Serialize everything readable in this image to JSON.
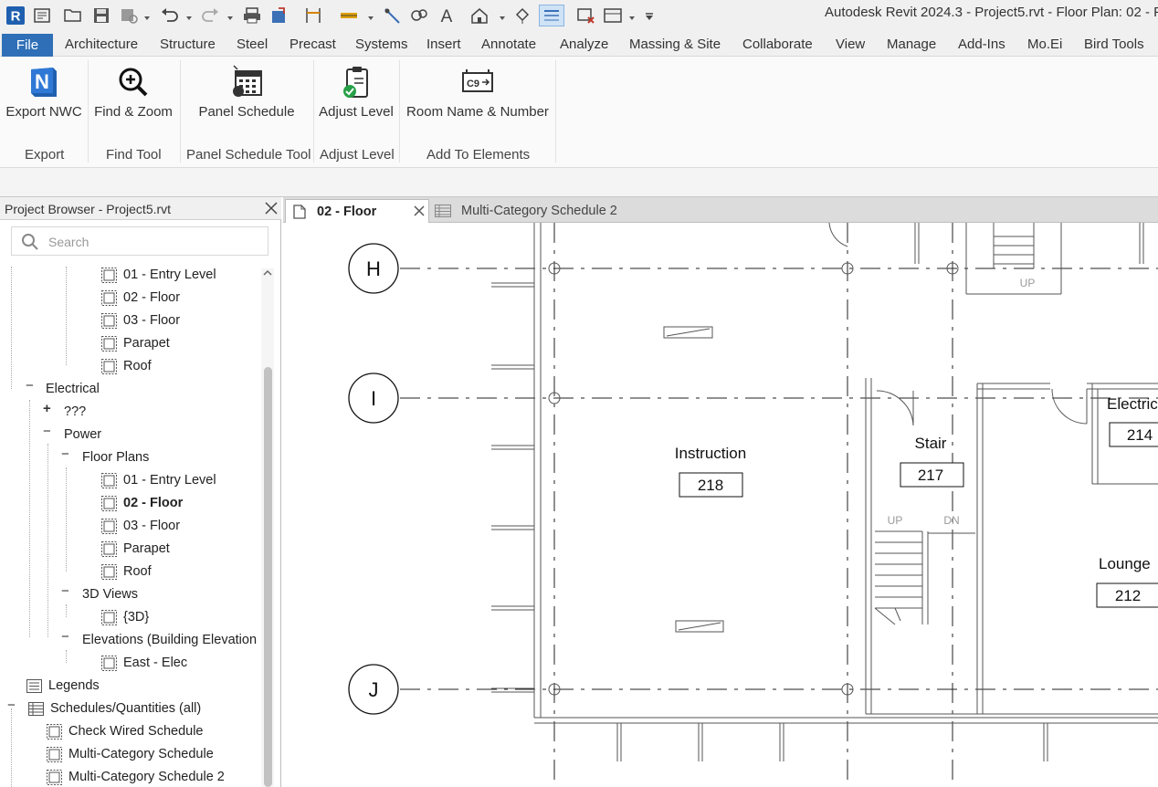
{
  "app": {
    "title": "Autodesk Revit 2024.3 - Project5.rvt - Floor Plan: 02 - Fl"
  },
  "menu": {
    "file": "File",
    "items": [
      "Architecture",
      "Structure",
      "Steel",
      "Precast",
      "Systems",
      "Insert",
      "Annotate",
      "Analyze",
      "Massing & Site",
      "Collaborate",
      "View",
      "Manage",
      "Add-Ins",
      "Mo.Ei",
      "Bird Tools"
    ]
  },
  "ribbon": {
    "buttons": [
      {
        "label": "Export NWC",
        "icon": "navisworks-n-icon"
      },
      {
        "label": "Find & Zoom",
        "icon": "zoom-magnifier-icon"
      },
      {
        "label": "Panel Schedule",
        "icon": "panel-schedule-calendar-icon"
      },
      {
        "label": "Adjust Level",
        "icon": "clipboard-check-icon"
      },
      {
        "label": "Room Name & Number",
        "icon": "room-tag-icon"
      }
    ],
    "panels": [
      "Export",
      "Find Tool",
      "Panel Schedule Tool",
      "Adjust Level",
      "Add To Elements"
    ]
  },
  "browser": {
    "title": "Project Browser - Project5.rvt",
    "search_placeholder": "Search",
    "tree": [
      "01 - Entry Level",
      "02 - Floor",
      "03 - Floor",
      "Parapet",
      "Roof",
      "Electrical",
      "???",
      "Power",
      "Floor Plans",
      "01 - Entry Level",
      "02 - Floor",
      "03 - Floor",
      "Parapet",
      "Roof",
      "3D Views",
      "{3D}",
      "Elevations (Building Elevation",
      "East - Elec",
      "Legends",
      "Schedules/Quantities (all)",
      "Check Wired Schedule",
      "Multi-Category Schedule",
      "Multi-Category Schedule 2"
    ]
  },
  "tabs": {
    "active": "02 - Floor",
    "inactive": "Multi-Category Schedule 2"
  },
  "plan": {
    "grids": [
      "H",
      "I",
      "J"
    ],
    "rooms": [
      {
        "name": "Instruction",
        "number": "218"
      },
      {
        "name": "Stair",
        "number": "217"
      },
      {
        "name": "Electric",
        "number": "214"
      },
      {
        "name": "Lounge",
        "number": "212"
      }
    ],
    "stair_labels": {
      "up": "UP",
      "dn": "DN"
    }
  },
  "colors": {
    "file_blue": "#2f6fb7",
    "revit_blue": "#1f5fb0"
  }
}
